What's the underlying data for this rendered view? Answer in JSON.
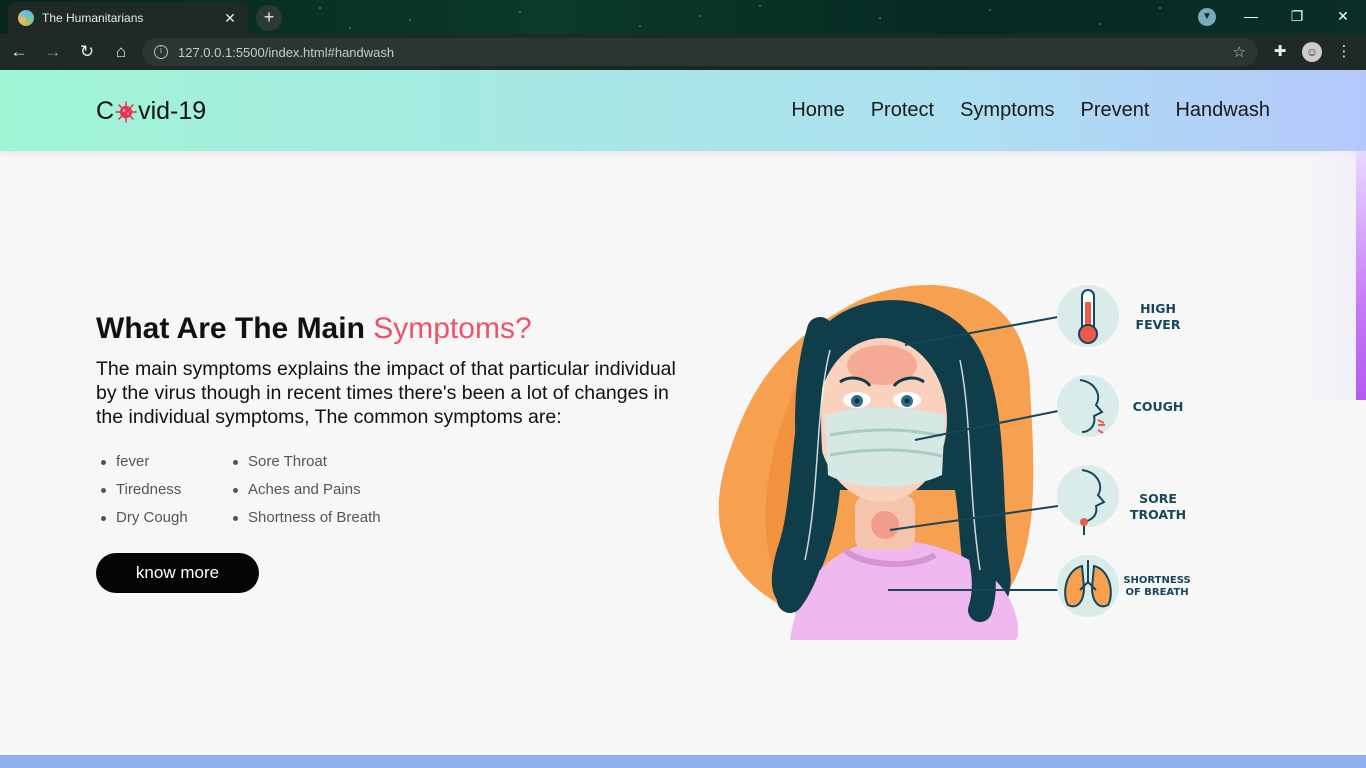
{
  "browser": {
    "tab_title": "The Humanitarians",
    "tab_close": "✕",
    "new_tab": "+",
    "url": "127.0.0.1:5500/index.html#handwash",
    "window_controls": {
      "minimize": "—",
      "restore": "❐",
      "close": "✕"
    }
  },
  "site": {
    "logo_prefix": "C",
    "logo_suffix": "vid-19",
    "nav": [
      "Home",
      "Protect",
      "Symptoms",
      "Prevent",
      "Handwash"
    ]
  },
  "symptoms_section": {
    "heading_main": "What Are The Main ",
    "heading_accent": "Symptoms?",
    "description": "The main symptoms explains the impact of that particular individual by the virus though in recent times there's been a lot of changes in the individual symptoms, The common symptoms are:",
    "list": [
      "fever",
      "Sore Throat",
      "Tiredness",
      "Aches and Pains",
      "Dry Cough",
      "Shortness of Breath"
    ],
    "cta": "know more"
  },
  "illustration": {
    "labels": {
      "fever_1": "HIGH",
      "fever_2": "FEVER",
      "cough": "COUGH",
      "sore_1": "SORE",
      "sore_2": "TROATH",
      "breath_1": "SHORTNESS",
      "breath_2": "OF BREATH"
    }
  },
  "colors": {
    "accent": "#f0526a",
    "cta_bg": "#050505",
    "label": "#17465a"
  }
}
